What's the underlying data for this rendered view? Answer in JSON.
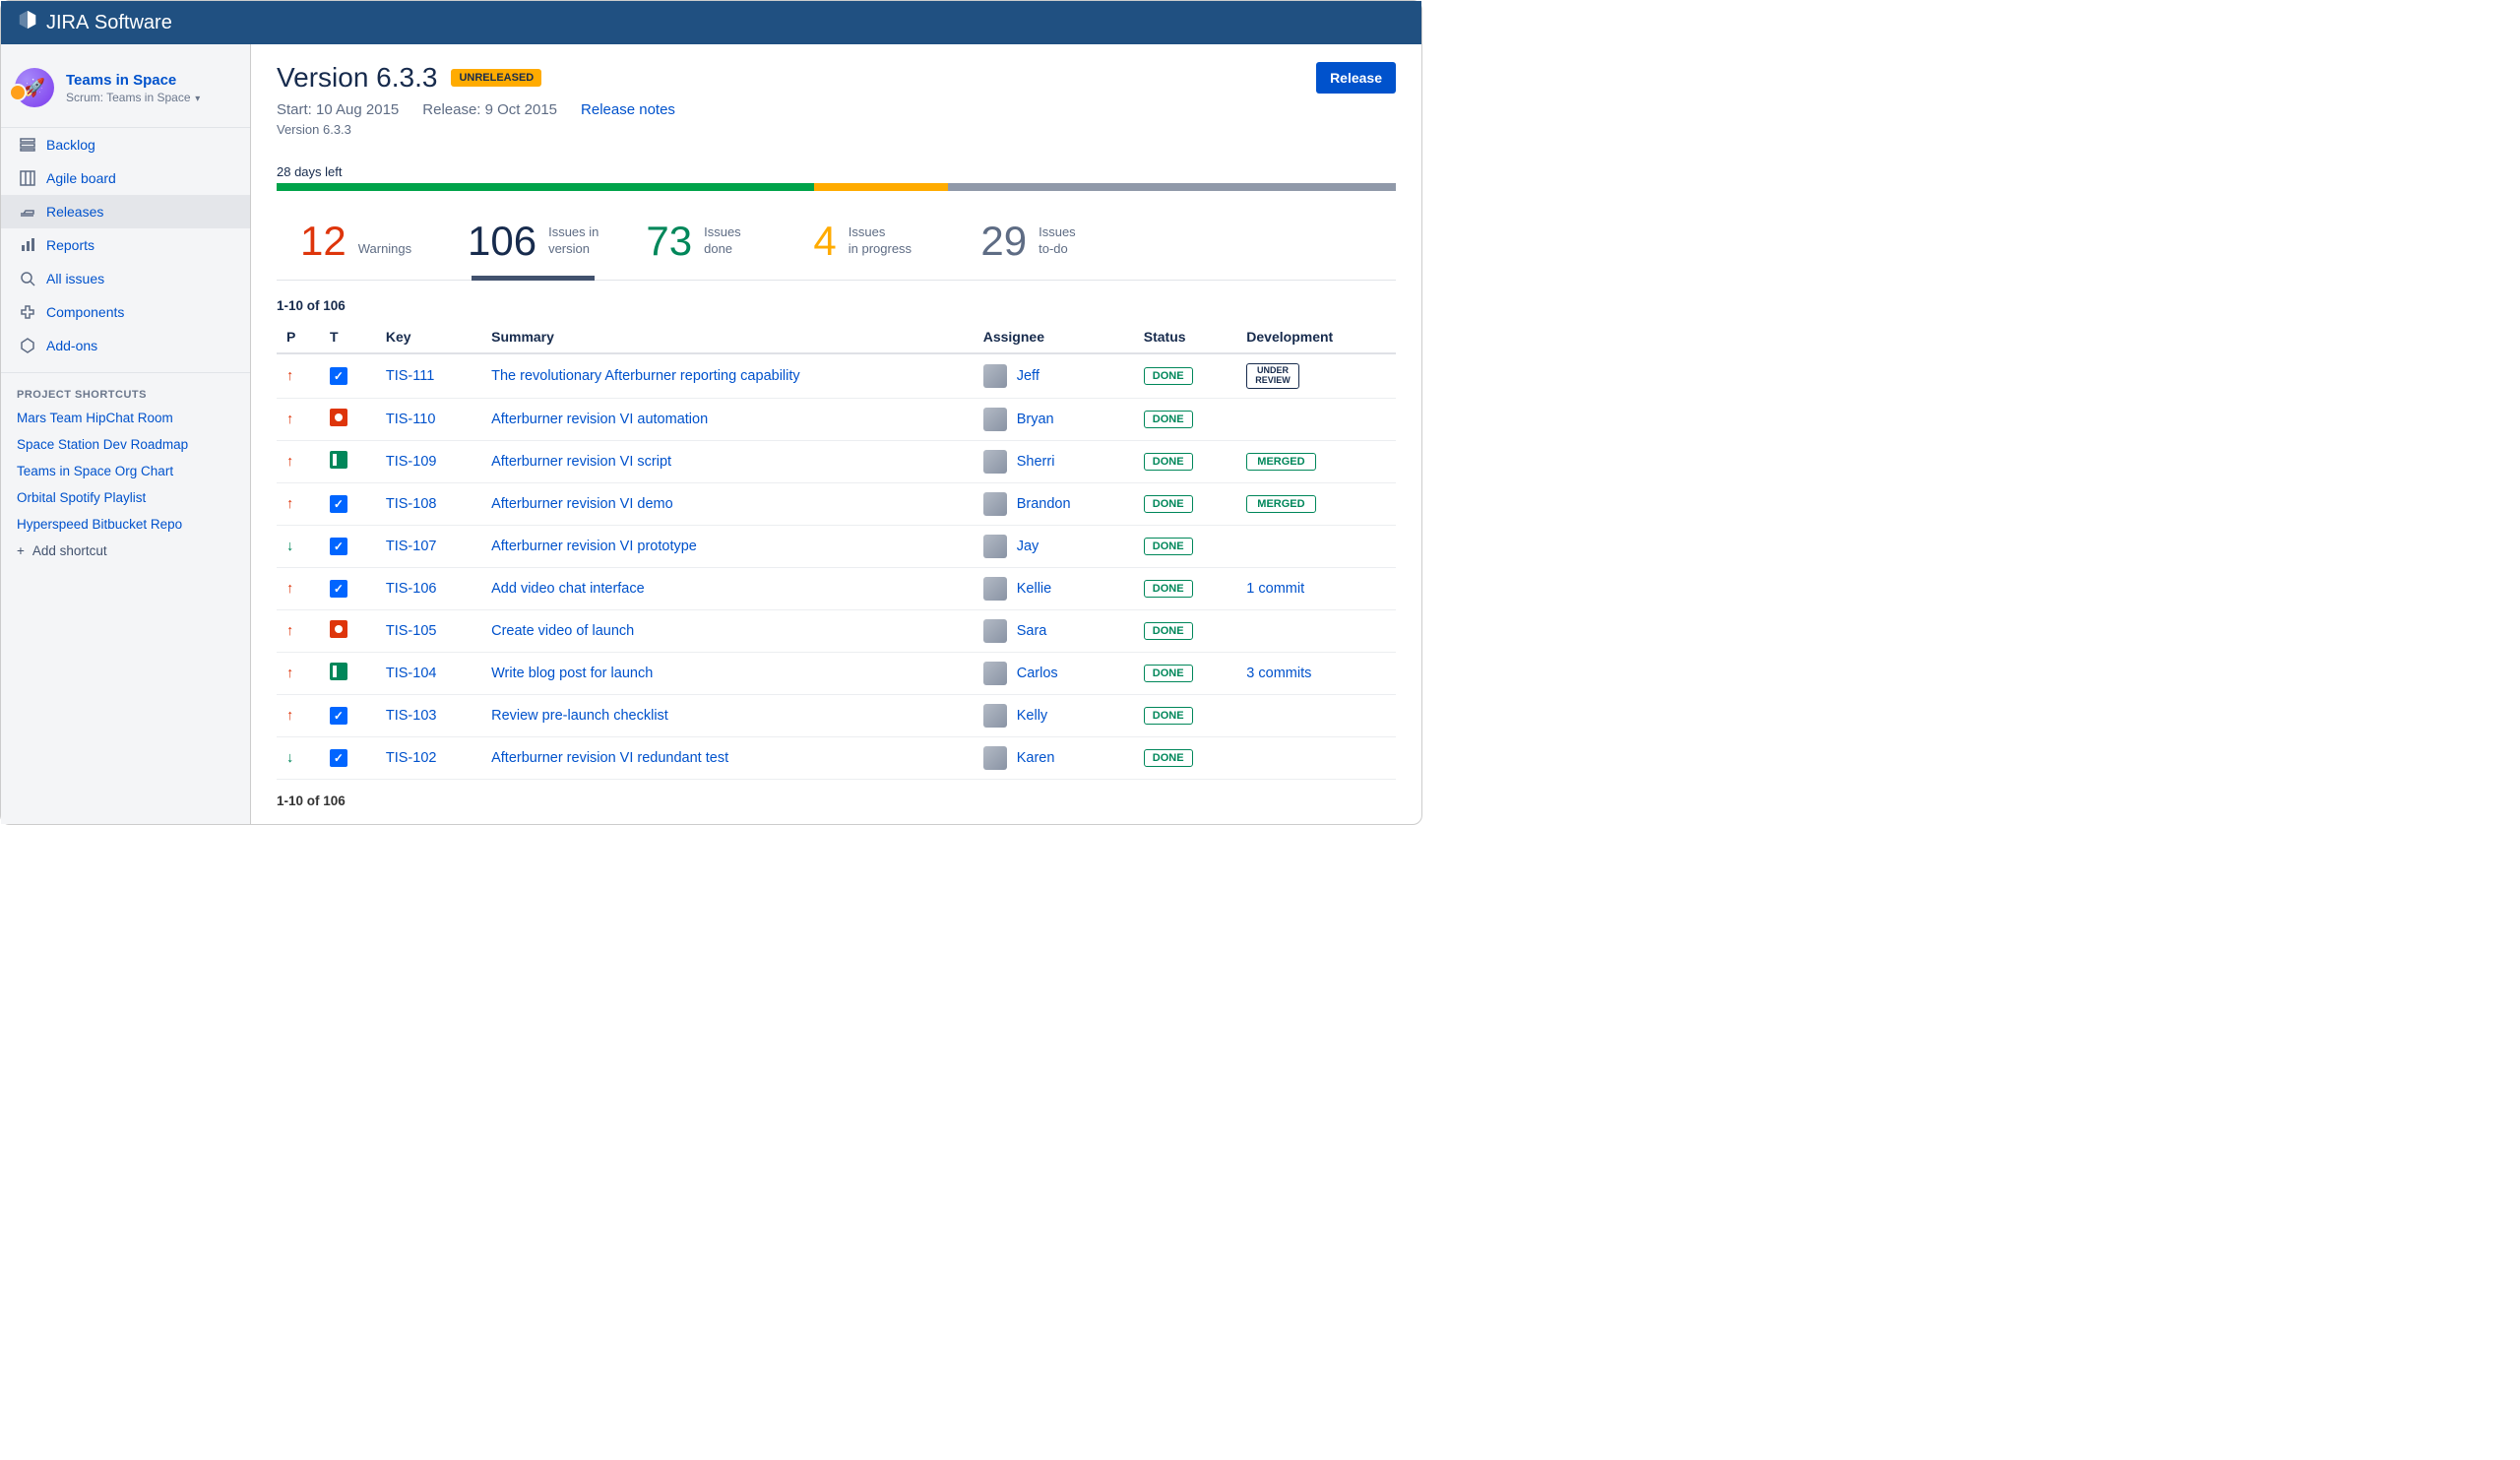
{
  "app": {
    "name_bold": "JIRA",
    "name_light": "Software"
  },
  "project": {
    "name": "Teams in Space",
    "type": "Scrum: Teams in Space"
  },
  "nav": {
    "items": [
      {
        "label": "Backlog",
        "icon": "backlog"
      },
      {
        "label": "Agile board",
        "icon": "board"
      },
      {
        "label": "Releases",
        "icon": "releases",
        "active": true
      },
      {
        "label": "Reports",
        "icon": "reports"
      },
      {
        "label": "All issues",
        "icon": "issues"
      },
      {
        "label": "Components",
        "icon": "components"
      },
      {
        "label": "Add-ons",
        "icon": "addons"
      }
    ]
  },
  "shortcuts": {
    "title": "PROJECT SHORTCUTS",
    "links": [
      "Mars Team HipChat Room",
      "Space Station Dev Roadmap",
      "Teams in Space Org Chart",
      "Orbital Spotify Playlist",
      "Hyperspeed Bitbucket Repo"
    ],
    "add_label": "Add shortcut"
  },
  "page": {
    "title": "Version 6.3.3",
    "status": "UNRELEASED",
    "release_button": "Release",
    "start_label": "Start: 10 Aug 2015",
    "release_label": "Release: 9 Oct 2015",
    "release_notes_link": "Release notes",
    "breadcrumb": "Version 6.3.3",
    "days_left": "28 days left"
  },
  "progress": {
    "done_pct": 48,
    "inprogress_pct": 12,
    "todo_pct": 40
  },
  "stats": {
    "warnings": {
      "value": "12",
      "label": "Warnings"
    },
    "issues": {
      "value": "106",
      "label1": "Issues in",
      "label2": "version"
    },
    "done": {
      "value": "73",
      "label1": "Issues",
      "label2": "done"
    },
    "inprog": {
      "value": "4",
      "label1": "Issues",
      "label2": "in progress"
    },
    "todo": {
      "value": "29",
      "label1": "Issues",
      "label2": "to-do"
    }
  },
  "table": {
    "pager": "1-10 of 106",
    "headers": {
      "p": "P",
      "t": "T",
      "key": "Key",
      "summary": "Summary",
      "assignee": "Assignee",
      "status": "Status",
      "development": "Development"
    },
    "rows": [
      {
        "priority": "up",
        "type": "task",
        "key": "TIS-111",
        "summary": "The revolutionary Afterburner reporting capability",
        "assignee": "Jeff",
        "status": "DONE",
        "dev_kind": "review",
        "dev_label1": "UNDER",
        "dev_label2": "REVIEW"
      },
      {
        "priority": "up",
        "type": "bug",
        "key": "TIS-110",
        "summary": "Afterburner revision VI automation",
        "assignee": "Bryan",
        "status": "DONE"
      },
      {
        "priority": "up",
        "type": "story",
        "key": "TIS-109",
        "summary": "Afterburner revision VI script",
        "assignee": "Sherri",
        "status": "DONE",
        "dev_kind": "merged",
        "dev_label": "MERGED"
      },
      {
        "priority": "up",
        "type": "task",
        "key": "TIS-108",
        "summary": "Afterburner revision VI demo",
        "assignee": "Brandon",
        "status": "DONE",
        "dev_kind": "merged",
        "dev_label": "MERGED"
      },
      {
        "priority": "down",
        "type": "task",
        "key": "TIS-107",
        "summary": "Afterburner revision VI prototype",
        "assignee": "Jay",
        "status": "DONE"
      },
      {
        "priority": "up",
        "type": "task",
        "key": "TIS-106",
        "summary": "Add video chat interface",
        "assignee": "Kellie",
        "status": "DONE",
        "dev_kind": "link",
        "dev_label": "1 commit"
      },
      {
        "priority": "up",
        "type": "bug",
        "key": "TIS-105",
        "summary": "Create video of launch",
        "assignee": "Sara",
        "status": "DONE"
      },
      {
        "priority": "up",
        "type": "story",
        "key": "TIS-104",
        "summary": "Write blog post for launch",
        "assignee": "Carlos",
        "status": "DONE",
        "dev_kind": "link",
        "dev_label": "3 commits"
      },
      {
        "priority": "up",
        "type": "task",
        "key": "TIS-103",
        "summary": "Review pre-launch checklist",
        "assignee": "Kelly",
        "status": "DONE"
      },
      {
        "priority": "down",
        "type": "task",
        "key": "TIS-102",
        "summary": "Afterburner revision VI redundant test",
        "assignee": "Karen",
        "status": "DONE"
      }
    ]
  }
}
